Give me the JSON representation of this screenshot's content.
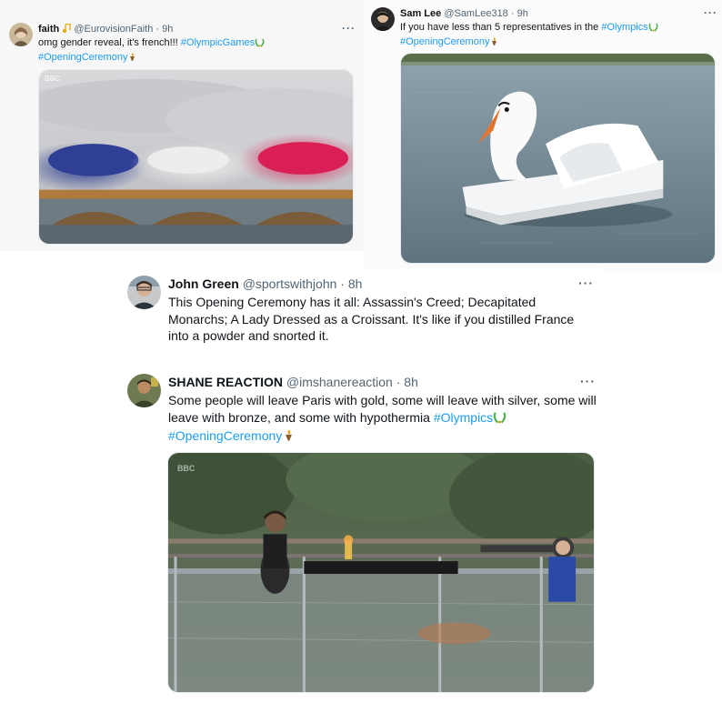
{
  "tweets": [
    {
      "name": "faith",
      "badge_icon": "music-note-emoji",
      "handle": "@EurovisionFaith",
      "separator": "·",
      "time": "9h",
      "more": "···",
      "text": "omg gender reveal, it's french!!! ",
      "hashtags": [
        "#OlympicGames",
        "#OpeningCeremony"
      ],
      "hashtag_icons": [
        "olympic-laurel-icon",
        "olympic-torch-icon"
      ],
      "media": {
        "watermark": "BBC",
        "subject": "bridge-with-tricolour-smoke"
      }
    },
    {
      "name": "Sam Lee",
      "handle": "@SamLee318",
      "separator": "·",
      "time": "9h",
      "more": "···",
      "text": "If you have less than 5 representatives in the ",
      "hashtags": [
        "#Olympics",
        "#OpeningCeremony"
      ],
      "hashtag_icons": [
        "olympic-laurel-icon",
        "olympic-torch-icon"
      ],
      "media": {
        "subject": "swan-pedal-boat-on-lake"
      }
    },
    {
      "name": "John Green",
      "handle": "@sportswithjohn",
      "separator": "·",
      "time": "8h",
      "more": "···",
      "text": "This Opening Ceremony has it all: Assassin's Creed; Decapitated Monarchs; A Lady Dressed as a Croissant. It's like if you distilled France into a powder and snorted it."
    },
    {
      "name": "SHANE REACTION",
      "handle": "@imshanereaction",
      "separator": "·",
      "time": "8h",
      "more": "···",
      "text": "Some people will leave Paris with gold, some will leave with silver, some will leave with bronze, and some with hypothermia ",
      "hashtags": [
        "#Olympics",
        "#OpeningCeremony"
      ],
      "hashtag_icons": [
        "olympic-laurel-icon",
        "olympic-torch-icon"
      ],
      "media": {
        "watermark": "BBC",
        "subject": "pianist-in-rain-on-boat"
      }
    }
  ],
  "colors": {
    "link": "#1d9bf0",
    "text": "#0f1419",
    "meta": "#536471",
    "flag_blue": "#1e3a8a",
    "flag_red": "#e11d48"
  }
}
